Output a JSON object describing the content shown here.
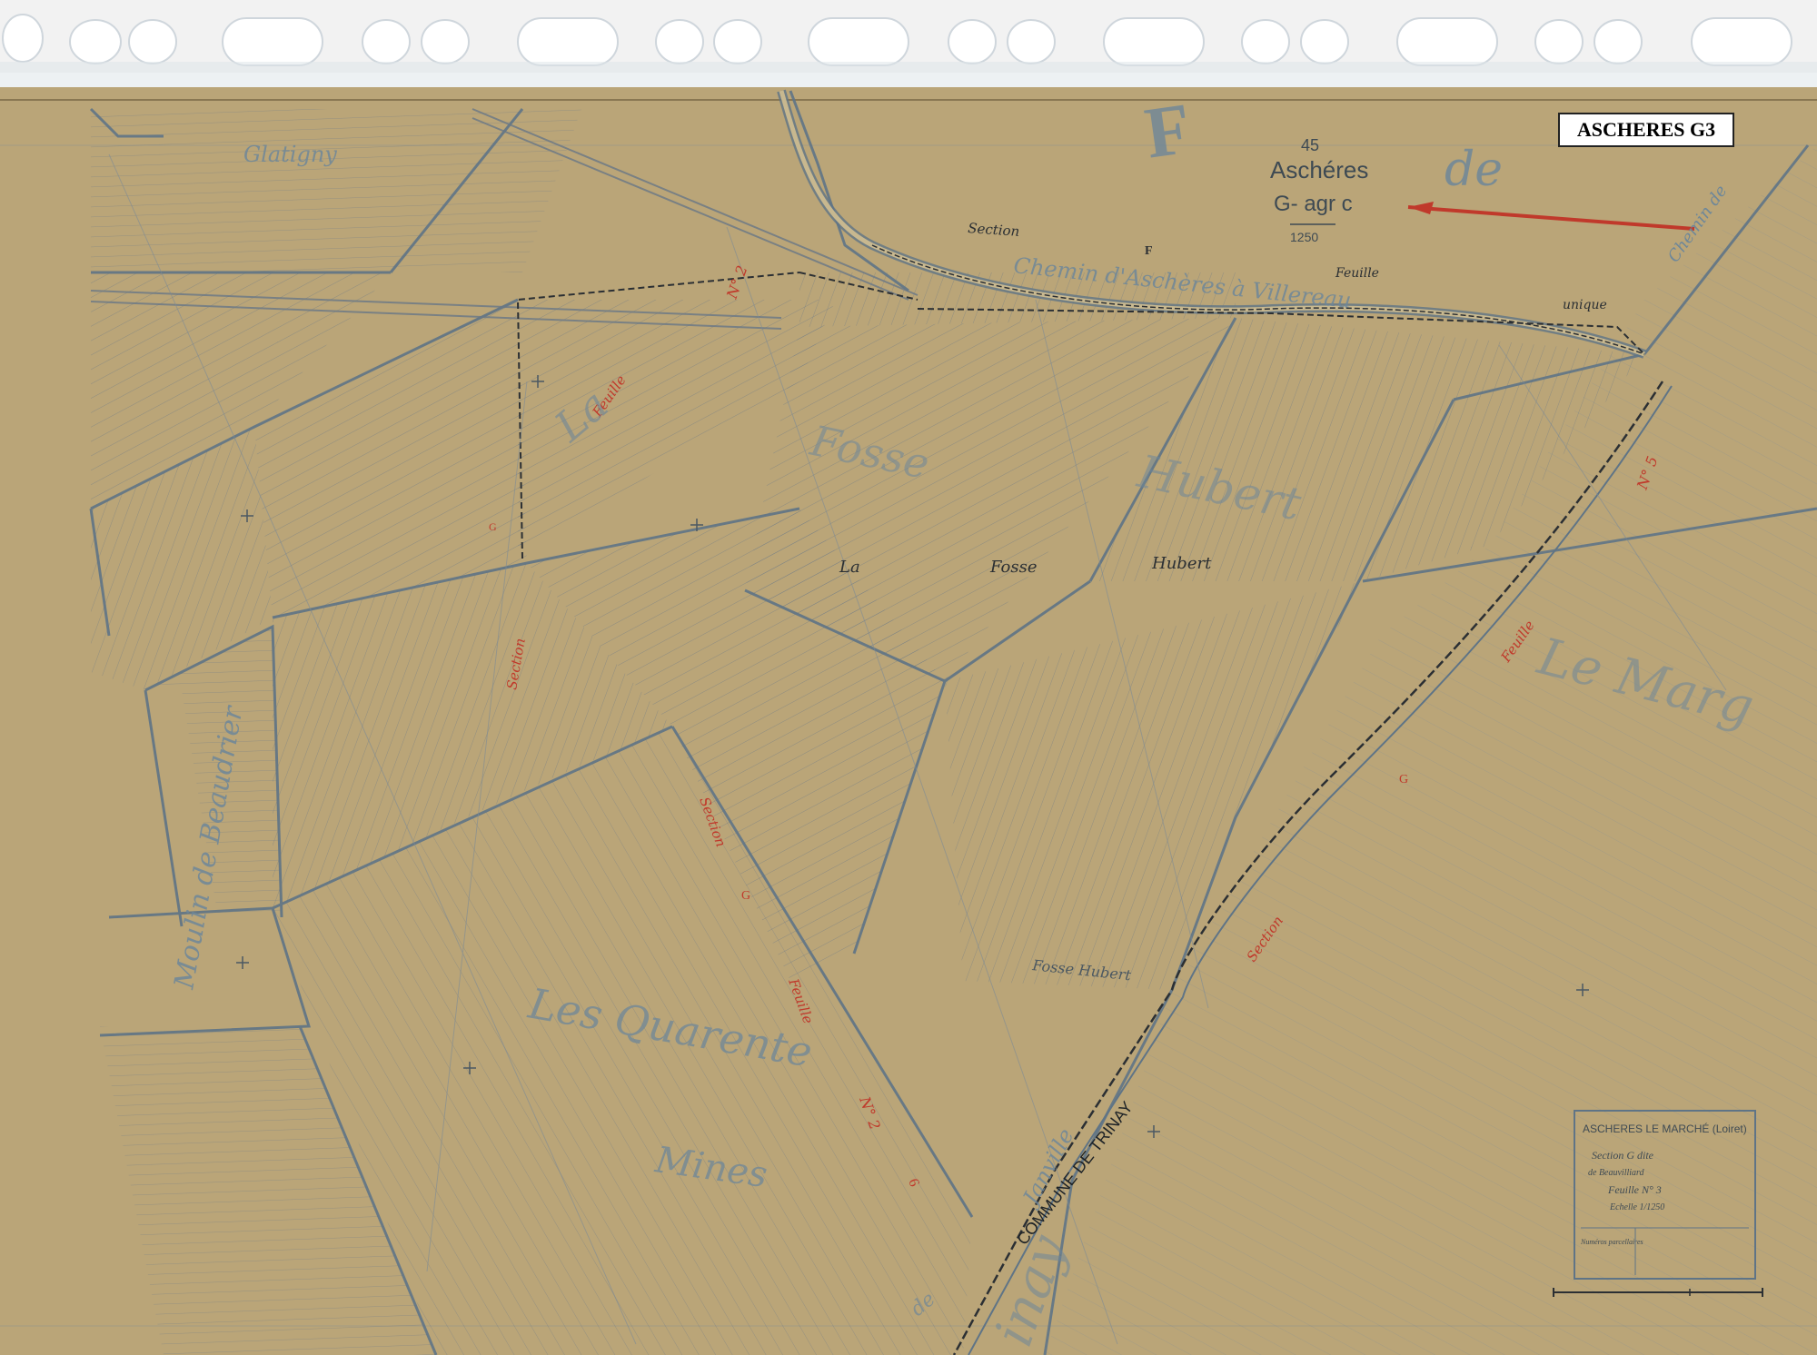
{
  "sheet_label": "ASCHERES G3",
  "header": {
    "number": "45",
    "commune": "Aschéres",
    "section_abbrev": "G- agr c",
    "scale": "1250",
    "word_de": "de",
    "big_letter": "F"
  },
  "place_names": {
    "glatigny": "Glatigny",
    "la": "La",
    "fosse_big": "Fosse",
    "hubert_big": "Hubert",
    "la_fosse_hubert_la": "La",
    "la_fosse_hubert_fosse": "Fosse",
    "la_fosse_hubert_hubert": "Hubert",
    "moulin": "Moulin de Beaudrier",
    "les_quarente": "Les Quarente",
    "mines": "Mines",
    "le_marg": "Le Marg",
    "commune_trinay": "COMMUNE DE TRINAY",
    "janville": "Janville",
    "trinay_big": "inay",
    "de_small": "de",
    "fosse_hubert_small": "Fosse Hubert"
  },
  "roads": {
    "chemin_villereau": "Chemin d'Aschères à Villereau",
    "chemin_top_right": "Chemin de",
    "unique": "unique",
    "feuille_top": "Feuille"
  },
  "section_labels": {
    "section_f": "Section",
    "f_letter": "F",
    "feuille_left": "Feuille",
    "section_left": "Section",
    "g_left": "G",
    "section_center": "Section",
    "g_center": "G",
    "feuille_center": "Feuille",
    "n2_center": "N° 2",
    "six_center": "6",
    "n2_top": "N° 2",
    "feuille_right": "Feuille",
    "g_right": "G",
    "n5_right": "N° 5",
    "section_right": "Section"
  },
  "cartouche": {
    "title": "ASCHERES LE MARCHÉ (Loiret)",
    "section_line": "Section G dite",
    "dite_name": "de Beauvilliard",
    "feuille_line": "Feuille N° 3",
    "echelle_line": "Echelle 1/1250",
    "numeros_line": "Numéros parcellaires"
  },
  "colors": {
    "paper": "#bca87b",
    "line": "#5f7486",
    "dark": "#2b2f33",
    "red": "#c0392b",
    "blue_text": "#6e8799"
  }
}
